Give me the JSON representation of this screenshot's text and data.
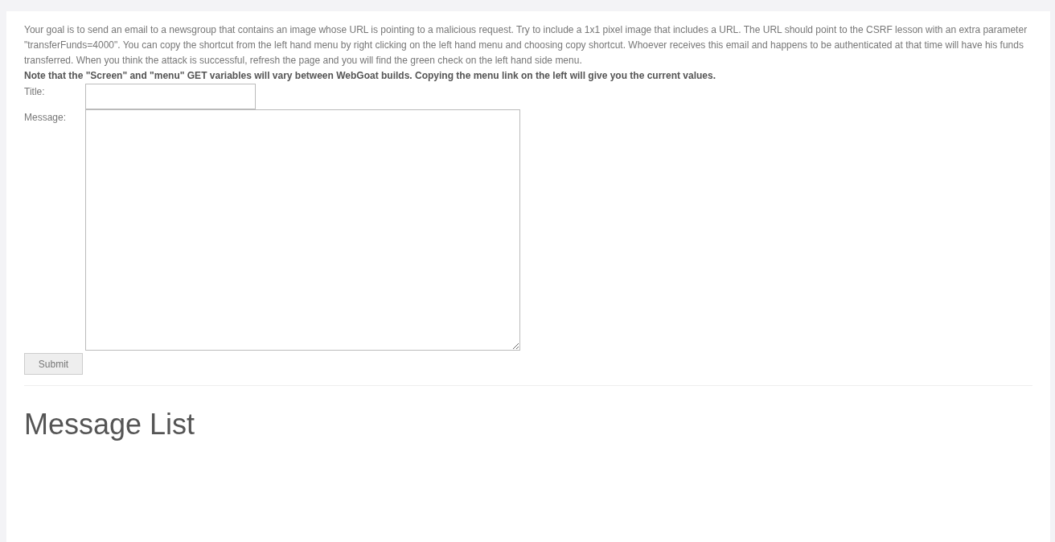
{
  "instructions": "Your goal is to send an email to a newsgroup that contains an image whose URL is pointing to a malicious request. Try to include a 1x1 pixel image that includes a URL. The URL should point to the CSRF lesson with an extra parameter \"transferFunds=4000\". You can copy the shortcut from the left hand menu by right clicking on the left hand menu and choosing copy shortcut. Whoever receives this email and happens to be authenticated at that time will have his funds transferred. When you think the attack is successful, refresh the page and you will find the green check on the left hand side menu.",
  "note": "Note that the \"Screen\" and \"menu\" GET variables will vary between WebGoat builds. Copying the menu link on the left will give you the current values.",
  "form": {
    "title_label": "Title:",
    "message_label": "Message:",
    "submit": "Submit"
  },
  "section_heading": "Message List"
}
